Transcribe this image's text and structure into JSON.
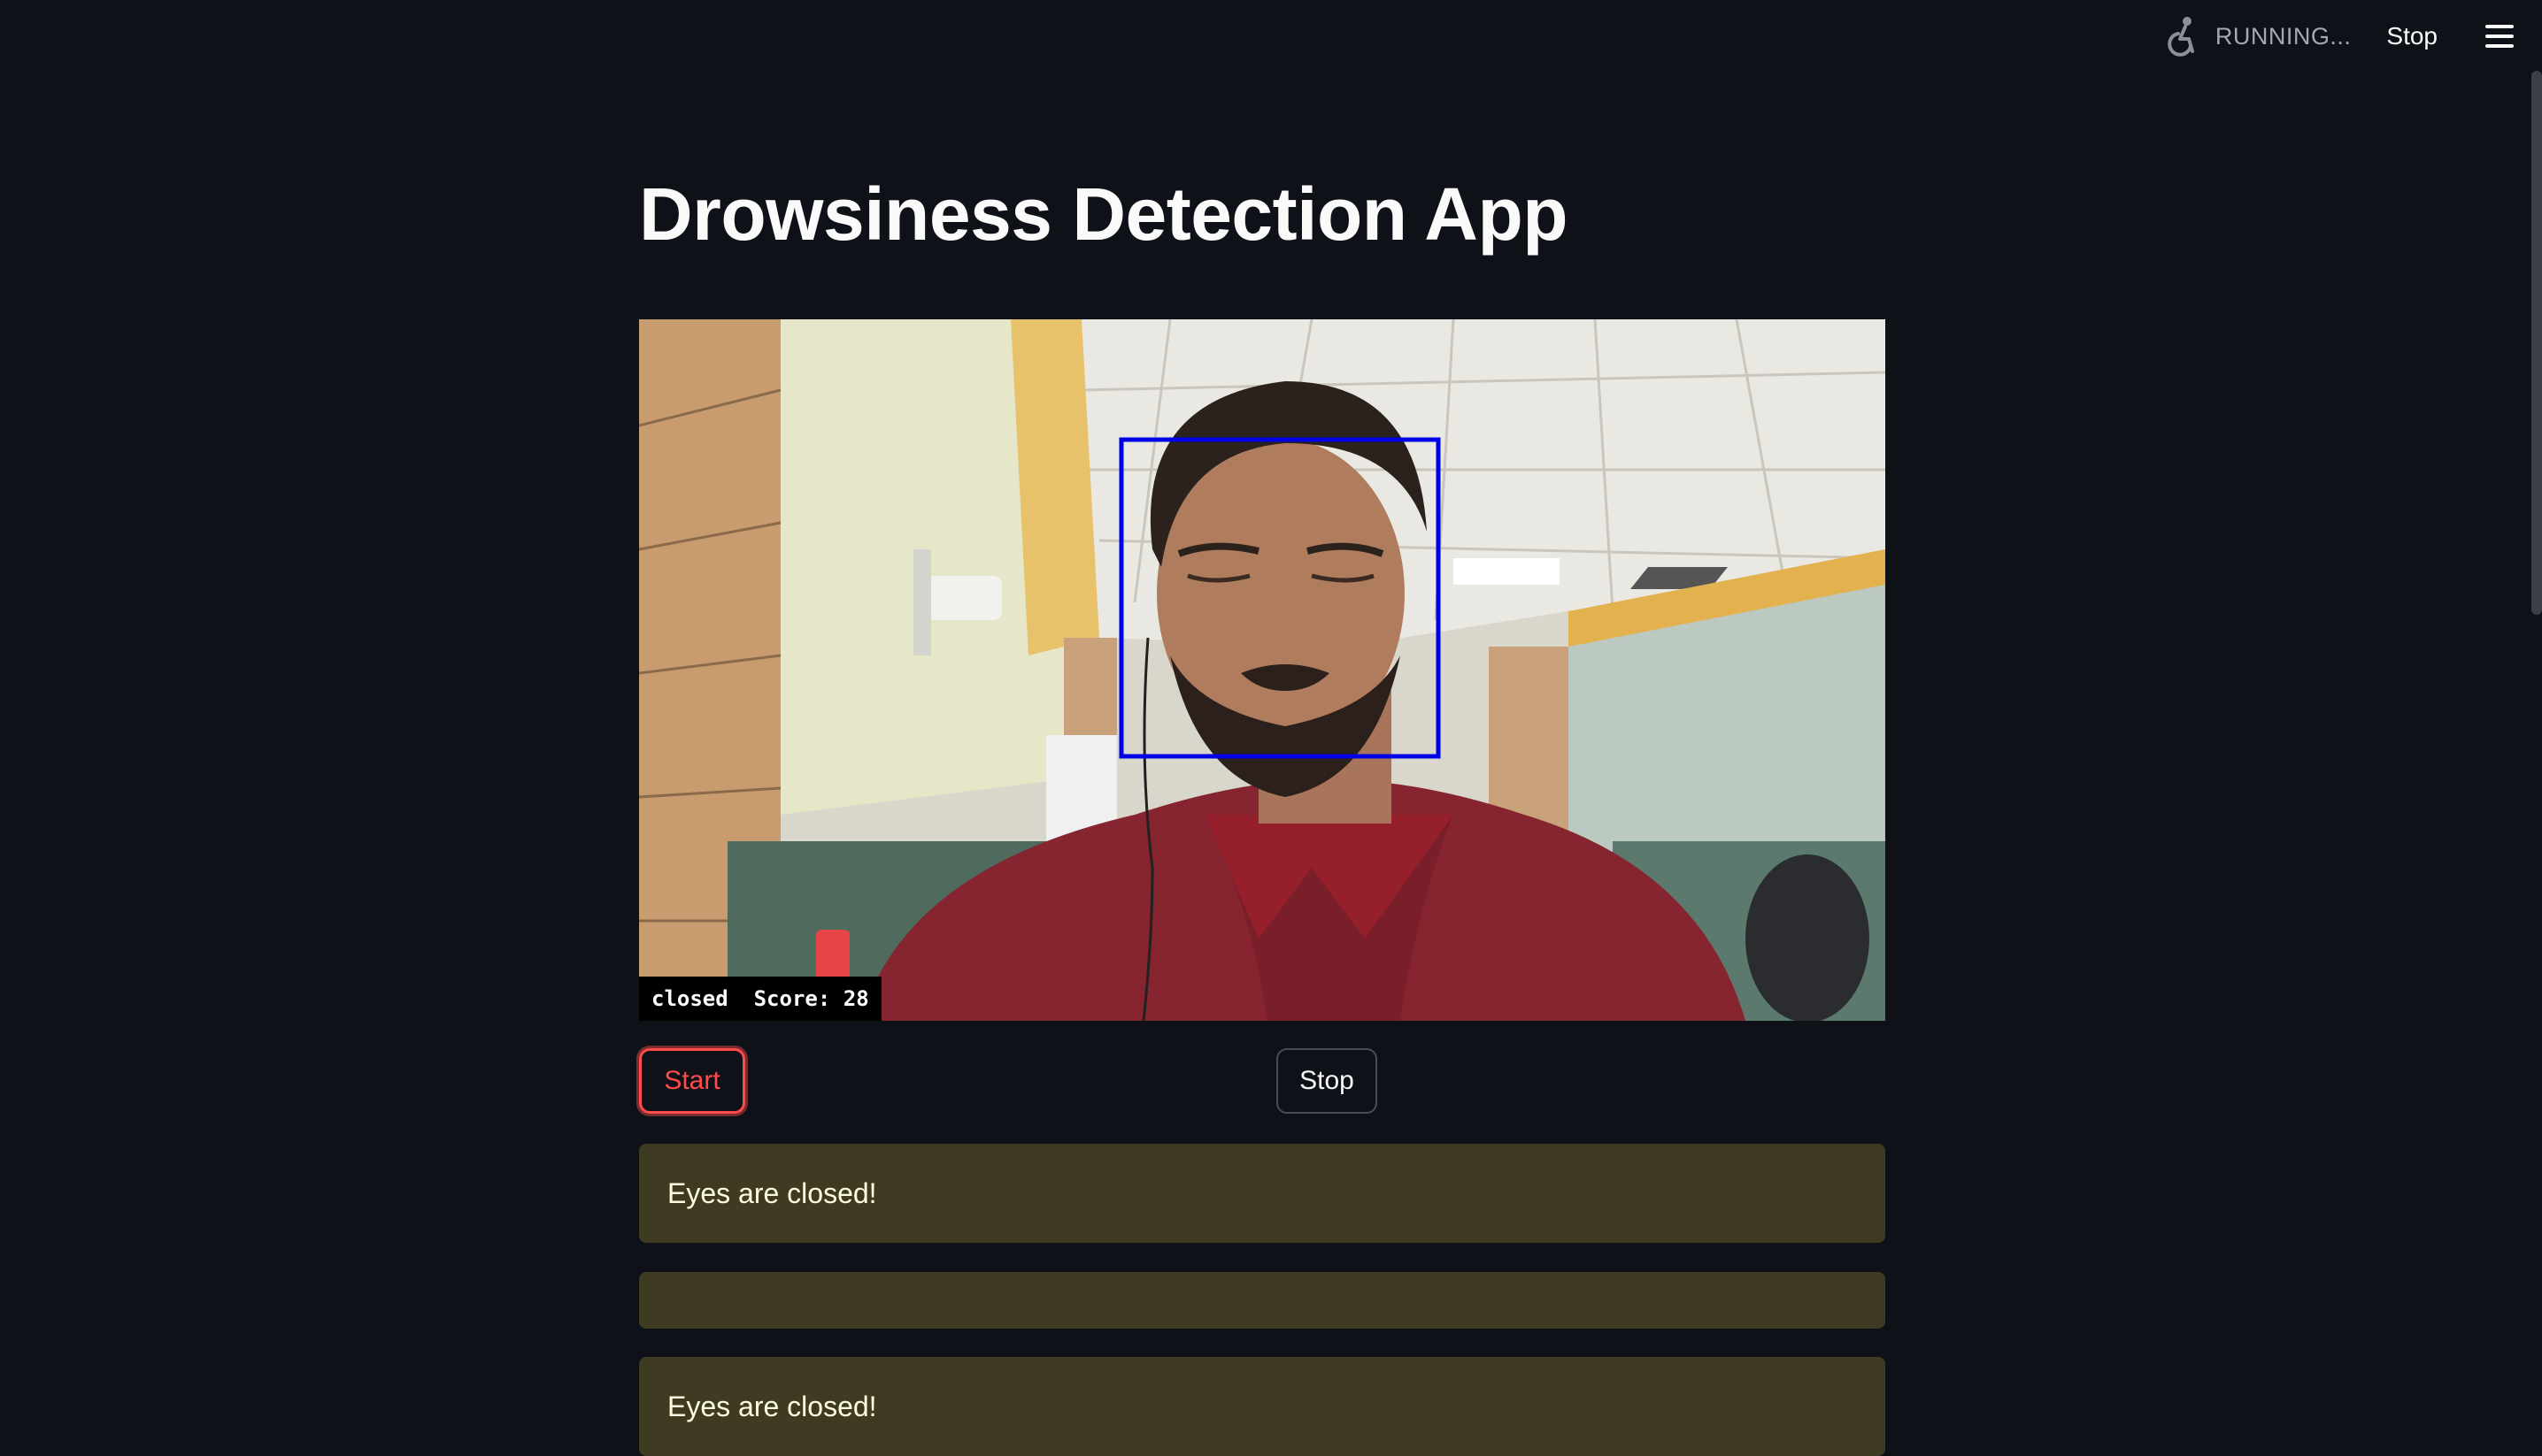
{
  "toolbar": {
    "status_text": "RUNNING...",
    "stop_label": "Stop",
    "running_icon": "running-person-icon",
    "menu_icon": "hamburger-menu-icon"
  },
  "main": {
    "title": "Drowsiness Detection App",
    "video": {
      "overlay_text": "closed  Score: 28",
      "face_box_color": "#0000e6"
    },
    "buttons": {
      "start_label": "Start",
      "stop_label": "Stop"
    },
    "alerts": [
      {
        "text": "Eyes are closed!"
      },
      {
        "text": ""
      },
      {
        "text": "Eyes are closed!"
      }
    ]
  },
  "colors": {
    "background": "#0e1117",
    "accent": "#ff4b4b",
    "alert_bg": "#3e3b22",
    "alert_text": "#fffde0"
  }
}
